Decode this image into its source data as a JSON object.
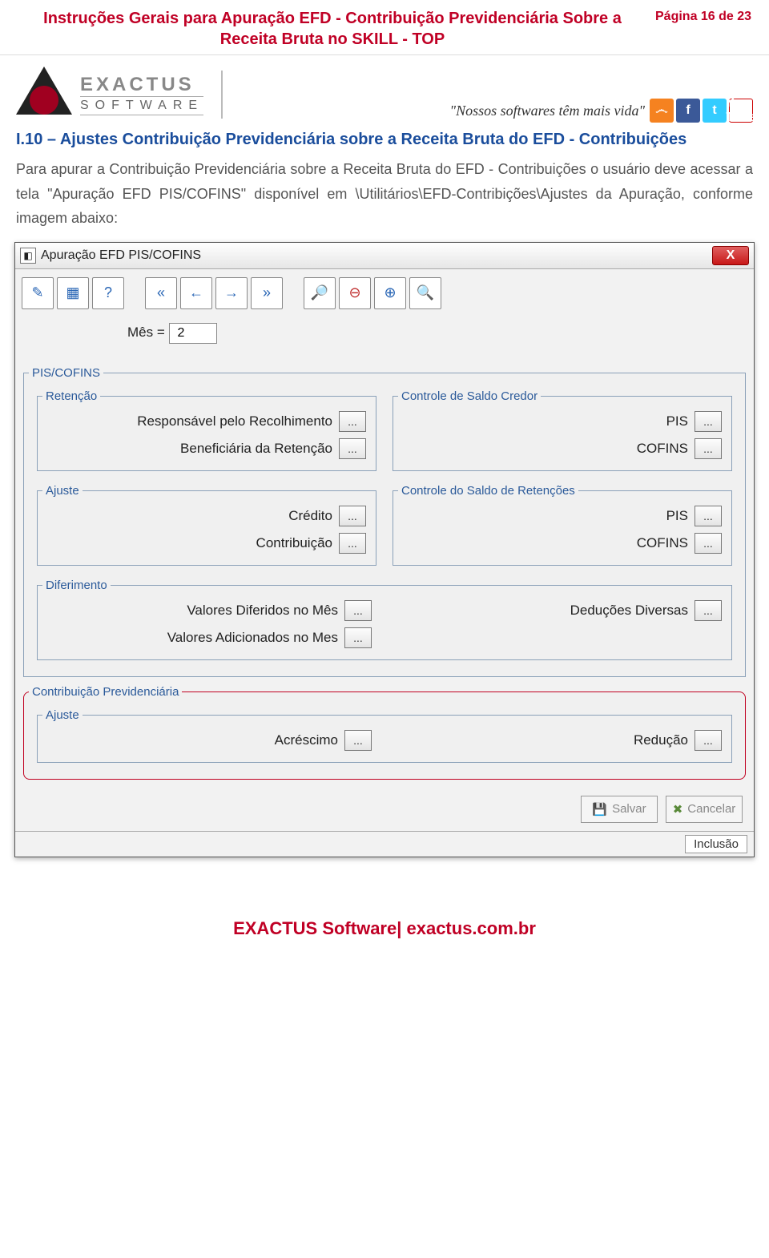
{
  "header": {
    "title": "Instruções Gerais para Apuração EFD - Contribuição Previdenciária Sobre a Receita Bruta no SKILL - TOP",
    "page_label": "Página 16 de 23"
  },
  "brand": {
    "name_line1": "EXACTUS",
    "name_line2": "SOFTWARE",
    "tagline": "\"Nossos softwares têm mais vida\""
  },
  "social": {
    "rss": "rss-icon",
    "facebook": "facebook-icon",
    "twitter": "twitter-icon",
    "youtube": "youtube-icon"
  },
  "section": {
    "heading": "I.10 – Ajustes Contribuição Previdenciária sobre a Receita Bruta do EFD - Contribuições",
    "body": "Para apurar a Contribuição Previdenciária sobre a Receita Bruta do EFD - Contribuições o usuário deve acessar a tela \"Apuração EFD PIS/COFINS\" disponível em \\Utilitários\\EFD-Contribições\\Ajustes da Apuração, conforme imagem abaixo:"
  },
  "dialog": {
    "title": "Apuração EFD PIS/COFINS",
    "close": "X",
    "toolbar_icons": [
      "edit-icon",
      "calc-icon",
      "help-icon",
      "first-icon",
      "prev-icon",
      "next-icon",
      "last-icon",
      "search-folder-icon",
      "remove-icon",
      "add-icon",
      "zoom-icon"
    ],
    "mes_label": "Mês =",
    "mes_value": "2",
    "groups": {
      "piscofins": "PIS/COFINS",
      "retencao": {
        "legend": "Retenção",
        "responsavel": "Responsável pelo Recolhimento",
        "beneficiaria": "Beneficiária da Retenção"
      },
      "saldo_credor": {
        "legend": "Controle de Saldo Credor",
        "pis": "PIS",
        "cofins": "COFINS"
      },
      "ajuste": {
        "legend": "Ajuste",
        "credito": "Crédito",
        "contribuicao": "Contribuição"
      },
      "saldo_retencoes": {
        "legend": "Controle do Saldo de Retenções",
        "pis": "PIS",
        "cofins": "COFINS"
      },
      "diferimento": {
        "legend": "Diferimento",
        "valores_diferidos": "Valores Diferidos no Mês",
        "valores_adicionados": "Valores Adicionados no Mes",
        "deducoes": "Deduções Diversas"
      },
      "contrib_prev": {
        "legend": "Contribuição Previdenciária",
        "ajuste_legend": "Ajuste",
        "acrescimo": "Acréscimo",
        "reducao": "Redução"
      }
    },
    "buttons": {
      "salvar": "Salvar",
      "cancelar": "Cancelar"
    },
    "status": "Inclusão",
    "ellipsis": "..."
  },
  "footer": {
    "text": "EXACTUS Software| exactus.com.br"
  }
}
